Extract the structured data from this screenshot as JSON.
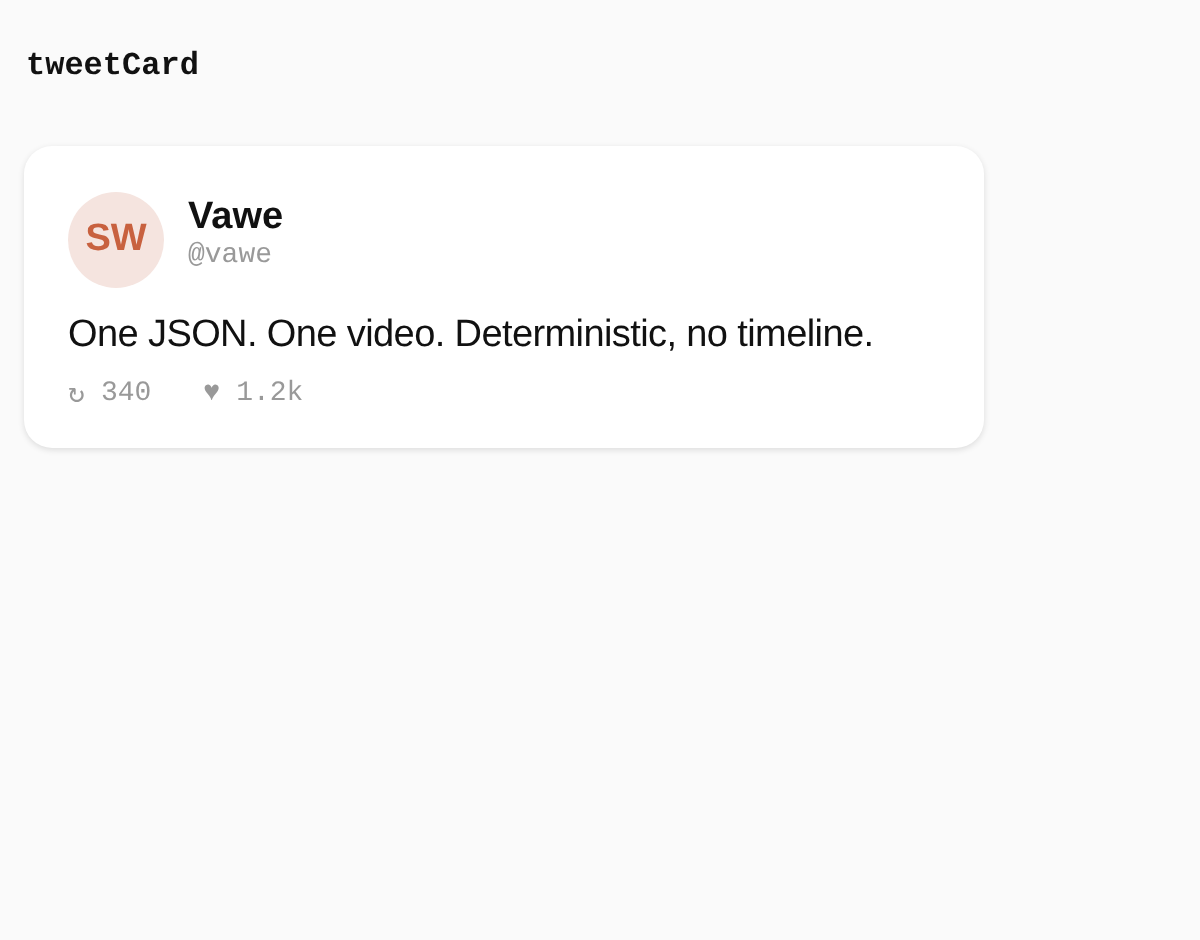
{
  "heading": "tweetCard",
  "tweet": {
    "avatar_initials": "SW",
    "name": "Vawe",
    "handle": "@vawe",
    "text": "One JSON. One video. Deterministic, no timeline.",
    "stats": [
      {
        "icon": "↻",
        "count": "340"
      },
      {
        "icon": "♥",
        "count": "1.2k"
      }
    ]
  }
}
